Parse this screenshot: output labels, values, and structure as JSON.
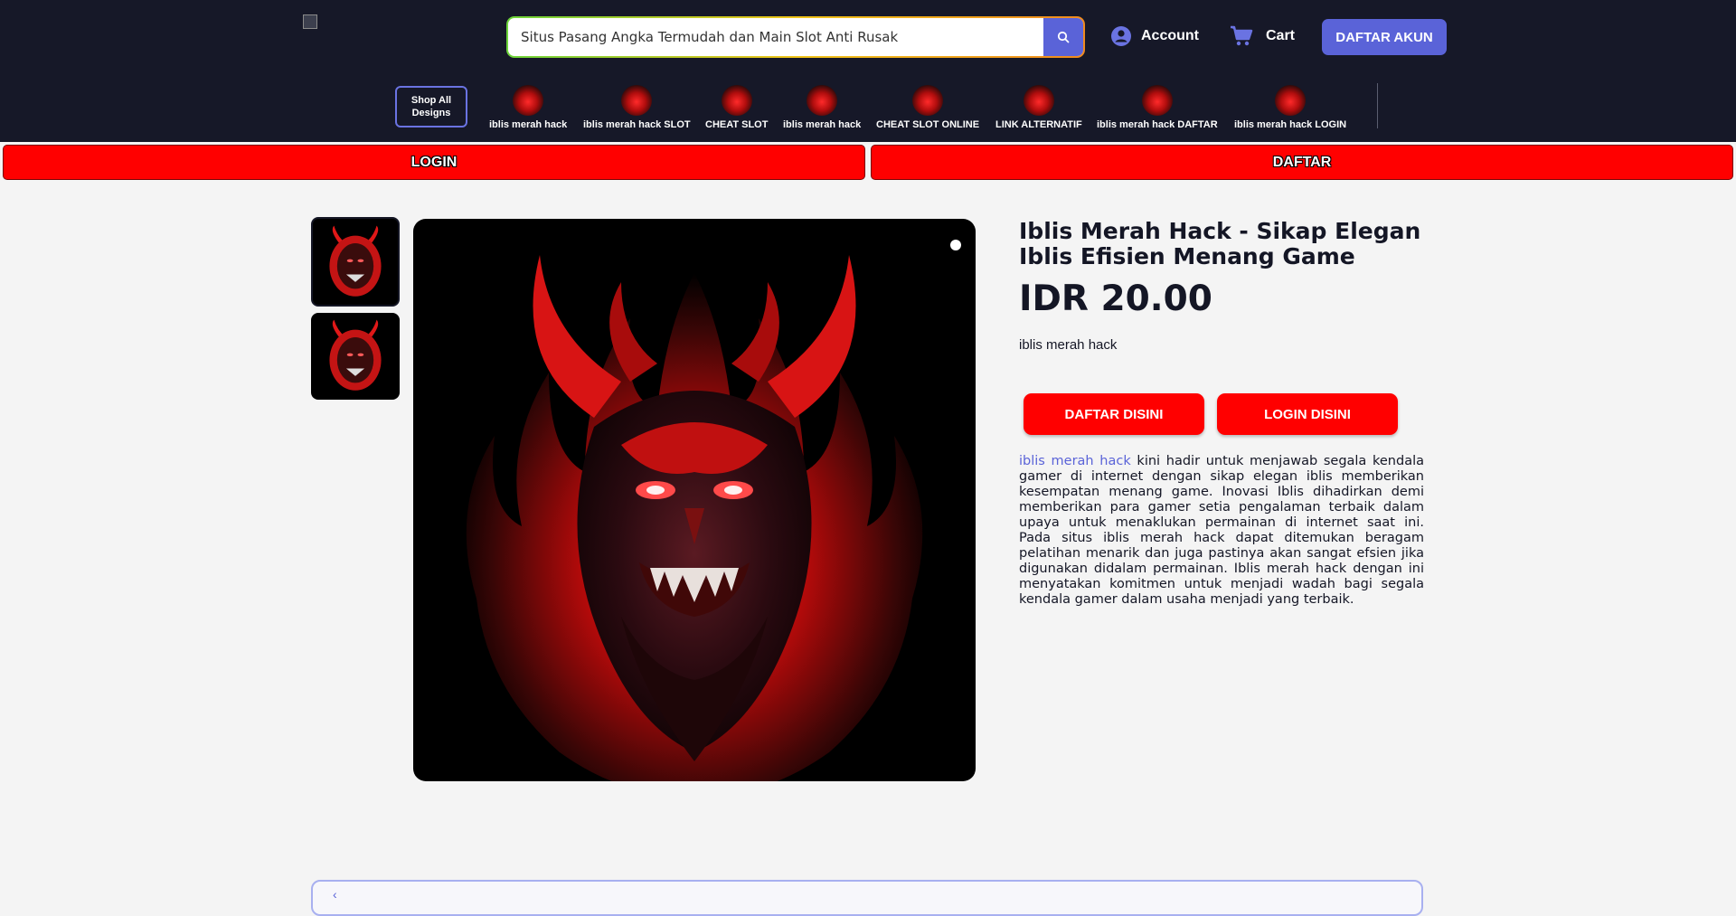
{
  "header": {
    "search_value": "Situs Pasang Angka Termudah dan Main Slot Anti Rusak",
    "account_label": "Account",
    "cart_label": "Cart",
    "daftar_akun_label": "DAFTAR AKUN"
  },
  "nav": {
    "shop_all": "Shop All Designs",
    "items": [
      {
        "label": "iblis merah hack"
      },
      {
        "label": "iblis merah hack SLOT"
      },
      {
        "label": "CHEAT SLOT"
      },
      {
        "label": "iblis merah hack"
      },
      {
        "label": "CHEAT SLOT ONLINE"
      },
      {
        "label": "LINK ALTERNATIF"
      },
      {
        "label": "iblis merah hack DAFTAR"
      },
      {
        "label": "iblis merah hack LOGIN"
      }
    ]
  },
  "bars": {
    "login": "LOGIN",
    "daftar": "DAFTAR"
  },
  "product": {
    "title": "Iblis Merah Hack - Sikap Elegan Iblis Efisien Menang Game",
    "price": "IDR 20.00",
    "subtitle": "iblis merah hack",
    "daftar_btn": "DAFTAR DISINI",
    "login_btn": "LOGIN DISINI",
    "desc_link": "iblis merah hack",
    "desc_rest": " kini hadir untuk menjawab segala kendala gamer di internet dengan sikap elegan iblis memberikan kesempatan menang game. Inovasi Iblis dihadirkan demi memberikan para gamer setia pengalaman terbaik dalam upaya untuk menaklukan permainan di internet saat ini. Pada situs iblis merah hack dapat ditemukan beragam pelatihan menarik dan juga pastinya akan sangat efsien jika digunakan didalam permainan. Iblis merah hack dengan ini menyatakan komitmen untuk menjadi wadah bagi segala kendala gamer dalam usaha menjadi yang terbaik."
  },
  "colors": {
    "header_bg": "#161828",
    "accent": "#5a63d8",
    "red": "#ff0000"
  }
}
